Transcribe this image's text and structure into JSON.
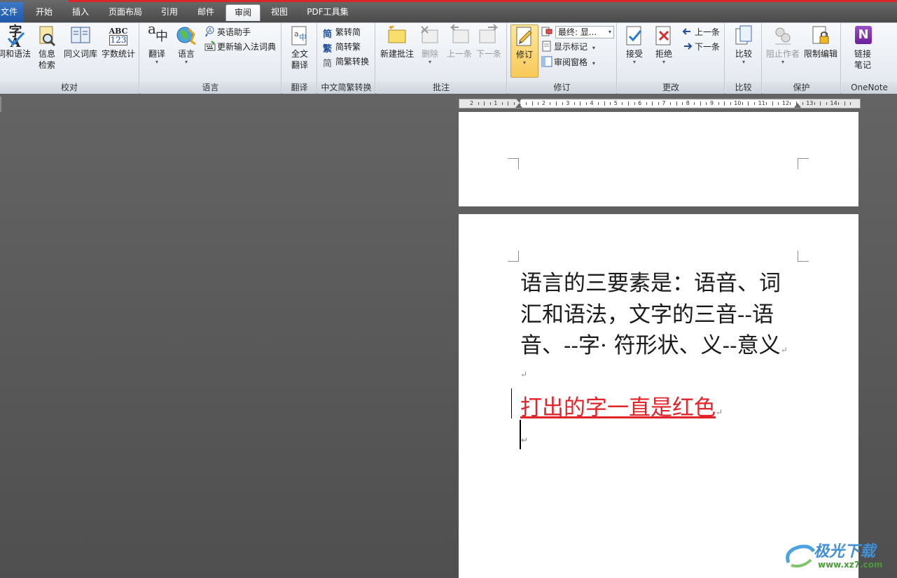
{
  "tabs": [
    {
      "id": "file",
      "label": "文件"
    },
    {
      "id": "home",
      "label": "开始"
    },
    {
      "id": "insert",
      "label": "插入"
    },
    {
      "id": "layout",
      "label": "页面布局"
    },
    {
      "id": "refs",
      "label": "引用"
    },
    {
      "id": "mail",
      "label": "邮件"
    },
    {
      "id": "review",
      "label": "审阅"
    },
    {
      "id": "view",
      "label": "视图"
    },
    {
      "id": "pdf",
      "label": "PDF工具集"
    }
  ],
  "ribbon": {
    "proofing": {
      "spelling": "字A",
      "spelling_label": "词和语法",
      "research_label": "信息\n检索",
      "research_l1": "信息",
      "research_l2": "检索",
      "thesaurus_label": "同义词库",
      "wordcount_icon_top": "ABC",
      "wordcount_icon_bottom": "123",
      "wordcount_label": "字数统计",
      "group_label": "校对"
    },
    "language": {
      "translate_icon_a": "a",
      "translate_icon_b": "中",
      "translate_label": "翻译",
      "language_label": "语言",
      "english_assistant": "英语助手",
      "update_ime": "更新输入法词典",
      "group_label": "语言"
    },
    "translate": {
      "full_l1": "全文",
      "full_l2": "翻译",
      "group_label": "翻译"
    },
    "chinese_conversion": {
      "to_simplified": "繁转简",
      "to_traditional": "简转繁",
      "conversion": "简繁转换",
      "group_label": "中文简繁转换",
      "icon_simplified": "简",
      "icon_traditional": "繁",
      "icon_conversion": "简"
    },
    "comments": {
      "new_comment": "新建批注",
      "delete": "删除",
      "previous": "上一条",
      "next": "下一条",
      "group_label": "批注"
    },
    "tracking": {
      "track_changes": "修订",
      "display_for_review": "最终: 显...",
      "show_markup": "显示标记",
      "reviewing_pane": "审阅窗格",
      "group_label": "修订"
    },
    "changes": {
      "accept": "接受",
      "reject": "拒绝",
      "previous": "上一条",
      "next": "下一条",
      "group_label": "更改"
    },
    "compare": {
      "compare": "比较",
      "group_label": "比较"
    },
    "protect": {
      "block_authors": "阻止作者",
      "restrict_editing": "限制编辑",
      "group_label": "保护"
    },
    "onenote": {
      "icon_letter": "N",
      "linked_l1": "链接",
      "linked_l2": "笔记",
      "group_label": "OneNote"
    }
  },
  "ruler": {
    "ticks": [
      "2",
      "1",
      "1",
      "2",
      "3",
      "4",
      "5",
      "6",
      "7",
      "8",
      "9",
      "10",
      "11",
      "12",
      "13",
      "14"
    ]
  },
  "document": {
    "line1": "语言的三要素是：语音、词",
    "line2": "汇和语法，文字的三音--语",
    "line3": "音、--字· 符形状、义--意义",
    "red_line": "打出的字一直是红色",
    "para_mark": "↵"
  },
  "watermark": {
    "text": "极光下载",
    "url": "www.xz7.com"
  },
  "colors": {
    "accent_red": "#e0242a",
    "file_tab": "#2b65b8",
    "tracked_changes_bar": "#000000"
  }
}
